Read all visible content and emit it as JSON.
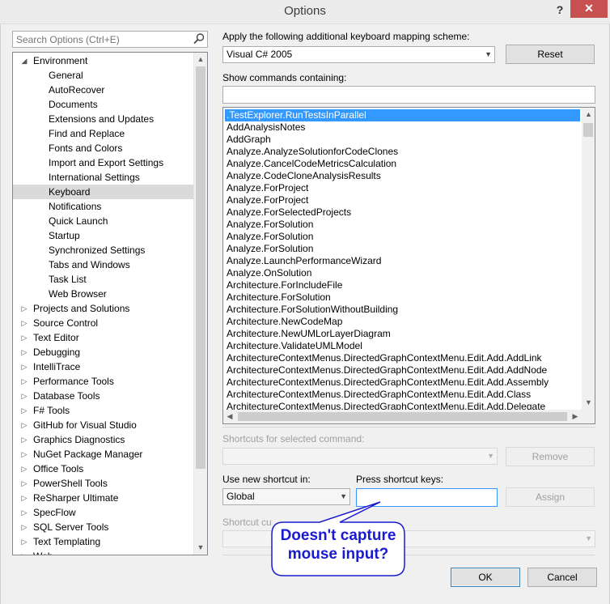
{
  "window": {
    "title": "Options",
    "help_label": "?",
    "close_label": "✕"
  },
  "search": {
    "placeholder": "Search Options (Ctrl+E)",
    "icon": "search-icon"
  },
  "tree": {
    "items": [
      {
        "label": "Environment",
        "expanded": true,
        "level": 0
      },
      {
        "label": "General",
        "level": 1
      },
      {
        "label": "AutoRecover",
        "level": 1
      },
      {
        "label": "Documents",
        "level": 1
      },
      {
        "label": "Extensions and Updates",
        "level": 1
      },
      {
        "label": "Find and Replace",
        "level": 1
      },
      {
        "label": "Fonts and Colors",
        "level": 1
      },
      {
        "label": "Import and Export Settings",
        "level": 1
      },
      {
        "label": "International Settings",
        "level": 1
      },
      {
        "label": "Keyboard",
        "level": 1,
        "selected": true
      },
      {
        "label": "Notifications",
        "level": 1
      },
      {
        "label": "Quick Launch",
        "level": 1
      },
      {
        "label": "Startup",
        "level": 1
      },
      {
        "label": "Synchronized Settings",
        "level": 1
      },
      {
        "label": "Tabs and Windows",
        "level": 1
      },
      {
        "label": "Task List",
        "level": 1
      },
      {
        "label": "Web Browser",
        "level": 1
      },
      {
        "label": "Projects and Solutions",
        "expanded": false,
        "level": 0
      },
      {
        "label": "Source Control",
        "expanded": false,
        "level": 0
      },
      {
        "label": "Text Editor",
        "expanded": false,
        "level": 0
      },
      {
        "label": "Debugging",
        "expanded": false,
        "level": 0
      },
      {
        "label": "IntelliTrace",
        "expanded": false,
        "level": 0
      },
      {
        "label": "Performance Tools",
        "expanded": false,
        "level": 0
      },
      {
        "label": "Database Tools",
        "expanded": false,
        "level": 0
      },
      {
        "label": "F# Tools",
        "expanded": false,
        "level": 0
      },
      {
        "label": "GitHub for Visual Studio",
        "expanded": false,
        "level": 0
      },
      {
        "label": "Graphics Diagnostics",
        "expanded": false,
        "level": 0
      },
      {
        "label": "NuGet Package Manager",
        "expanded": false,
        "level": 0
      },
      {
        "label": "Office Tools",
        "expanded": false,
        "level": 0
      },
      {
        "label": "PowerShell Tools",
        "expanded": false,
        "level": 0
      },
      {
        "label": "ReSharper Ultimate",
        "expanded": false,
        "level": 0
      },
      {
        "label": "SpecFlow",
        "expanded": false,
        "level": 0
      },
      {
        "label": "SQL Server Tools",
        "expanded": false,
        "level": 0
      },
      {
        "label": "Text Templating",
        "expanded": false,
        "level": 0
      },
      {
        "label": "Web",
        "expanded": false,
        "level": 0
      }
    ]
  },
  "mapping": {
    "label": "Apply the following additional keyboard mapping scheme:",
    "value": "Visual C# 2005",
    "reset_label": "Reset"
  },
  "show_commands": {
    "label": "Show commands containing:",
    "value": ""
  },
  "commands": [
    {
      "label": ".TestExplorer.RunTestsInParallel",
      "selected": true
    },
    {
      "label": "AddAnalysisNotes"
    },
    {
      "label": "AddGraph"
    },
    {
      "label": "Analyze.AnalyzeSolutionforCodeClones"
    },
    {
      "label": "Analyze.CancelCodeMetricsCalculation"
    },
    {
      "label": "Analyze.CodeCloneAnalysisResults"
    },
    {
      "label": "Analyze.ForProject"
    },
    {
      "label": "Analyze.ForProject"
    },
    {
      "label": "Analyze.ForSelectedProjects"
    },
    {
      "label": "Analyze.ForSolution"
    },
    {
      "label": "Analyze.ForSolution"
    },
    {
      "label": "Analyze.ForSolution"
    },
    {
      "label": "Analyze.LaunchPerformanceWizard"
    },
    {
      "label": "Analyze.OnSolution"
    },
    {
      "label": "Architecture.ForIncludeFile"
    },
    {
      "label": "Architecture.ForSolution"
    },
    {
      "label": "Architecture.ForSolutionWithoutBuilding"
    },
    {
      "label": "Architecture.NewCodeMap"
    },
    {
      "label": "Architecture.NewUMLorLayerDiagram"
    },
    {
      "label": "Architecture.ValidateUMLModel"
    },
    {
      "label": "ArchitectureContextMenus.DirectedGraphContextMenu.Edit.Add.AddLink"
    },
    {
      "label": "ArchitectureContextMenus.DirectedGraphContextMenu.Edit.Add.AddNode"
    },
    {
      "label": "ArchitectureContextMenus.DirectedGraphContextMenu.Edit.Add.Assembly"
    },
    {
      "label": "ArchitectureContextMenus.DirectedGraphContextMenu.Edit.Add.Class"
    },
    {
      "label": "ArchitectureContextMenus.DirectedGraphContextMenu.Edit.Add.Delegate"
    }
  ],
  "shortcuts_selected": {
    "label": "Shortcuts for selected command:",
    "value": "",
    "remove_label": "Remove"
  },
  "use_new_shortcut": {
    "label": "Use new shortcut in:",
    "value": "Global"
  },
  "press_keys": {
    "label": "Press shortcut keys:",
    "value": "",
    "assign_label": "Assign"
  },
  "shortcut_currently": {
    "label": "Shortcut cu",
    "value": ""
  },
  "annotation": {
    "line1": "Doesn't capture",
    "line2": "mouse input?",
    "color": "#1a1ad0"
  },
  "footer": {
    "ok_label": "OK",
    "cancel_label": "Cancel"
  }
}
